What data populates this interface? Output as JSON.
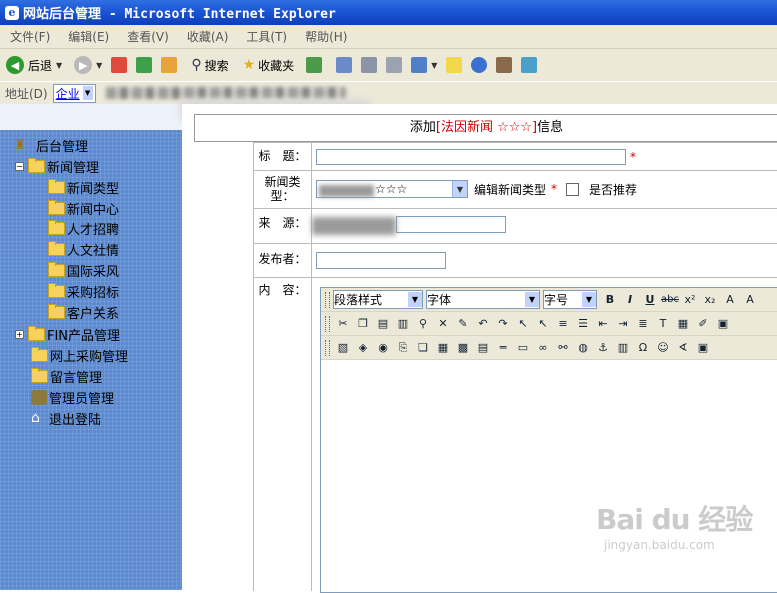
{
  "window": {
    "title": "网站后台管理 - Microsoft Internet Explorer"
  },
  "menu": [
    "文件(F)",
    "编辑(E)",
    "查看(V)",
    "收藏(A)",
    "工具(T)",
    "帮助(H)"
  ],
  "toolbar": {
    "back_label": "后退",
    "search_label": "搜索",
    "favorites_label": "收藏夹"
  },
  "address": {
    "label": "地址(D)",
    "dropdown_value": "企业"
  },
  "sidebar": {
    "root": "后台管理",
    "items": [
      {
        "label": "新闻管理",
        "level": 1,
        "expander": "−"
      },
      {
        "label": "新闻类型",
        "level": 2
      },
      {
        "label": "新闻中心",
        "level": 2
      },
      {
        "label": "人才招聘",
        "level": 2
      },
      {
        "label": "人文社情",
        "level": 2
      },
      {
        "label": "国际采风",
        "level": 2
      },
      {
        "label": "采购招标",
        "level": 2
      },
      {
        "label": "客户关系",
        "level": 2
      },
      {
        "label": "FIN产品管理",
        "level": 1,
        "expander": "+"
      },
      {
        "label": "网上采购管理",
        "level": 1
      },
      {
        "label": "留言管理",
        "level": 1
      },
      {
        "label": "管理员管理",
        "level": 1,
        "icon": "admin"
      },
      {
        "label": "退出登陆",
        "level": 1,
        "icon": "home"
      }
    ]
  },
  "form": {
    "title_prefix": "添加",
    "title_highlight": "[法因新闻 ☆☆☆]",
    "title_suffix": "信息",
    "title_label": "标　题：",
    "type_label_line1": "新闻类",
    "type_label_line2": "型：",
    "type_select_value": "☆☆☆",
    "edit_type_link": "编辑新闻类型",
    "recommend_label": "是否推荐",
    "source_label": "来　源：",
    "publisher_label": "发布者：",
    "content_label": "内　容：",
    "required_mark": "*"
  },
  "editor": {
    "paragraph_style": "段落样式",
    "font": "字体",
    "font_size": "字号"
  },
  "watermark": {
    "main": "Bai du 经验",
    "sub": "jingyan.baidu.com"
  }
}
